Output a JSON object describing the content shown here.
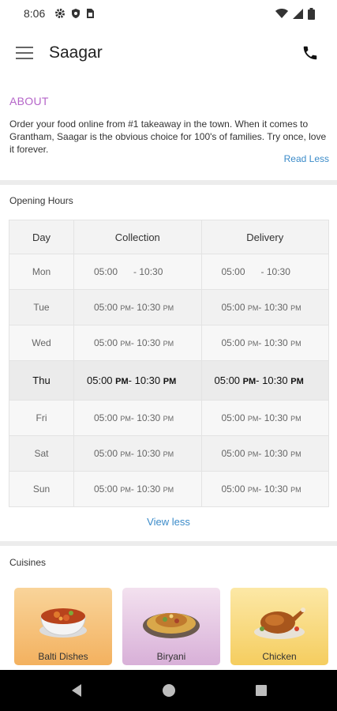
{
  "status": {
    "time": "8:06"
  },
  "header": {
    "title": "Saagar"
  },
  "about": {
    "title": "ABOUT",
    "text": "Order your food online from #1 takeaway in the town. When it comes to Grantham, Saagar is the obvious choice for 100's of families. Try once, love it forever.",
    "read_less": "Read Less"
  },
  "hours": {
    "title": "Opening Hours",
    "headers": [
      "Day",
      "Collection",
      "Delivery"
    ],
    "rows": [
      {
        "day": "Mon",
        "collection": {
          "open": "05:00",
          "open_ampm": "",
          "close": "- 10:30",
          "close_ampm": ""
        },
        "delivery": {
          "open": "05:00",
          "open_ampm": "",
          "close": "- 10:30",
          "close_ampm": ""
        }
      },
      {
        "day": "Tue",
        "collection": {
          "open": "05:00",
          "open_ampm": "PM",
          "close": "- 10:30",
          "close_ampm": "PM"
        },
        "delivery": {
          "open": "05:00",
          "open_ampm": "PM",
          "close": "- 10:30",
          "close_ampm": "PM"
        }
      },
      {
        "day": "Wed",
        "collection": {
          "open": "05:00",
          "open_ampm": "PM",
          "close": "- 10:30",
          "close_ampm": "PM"
        },
        "delivery": {
          "open": "05:00",
          "open_ampm": "PM",
          "close": "- 10:30",
          "close_ampm": "PM"
        }
      },
      {
        "day": "Thu",
        "collection": {
          "open": "05:00",
          "open_ampm": "PM",
          "close": "- 10:30",
          "close_ampm": "PM"
        },
        "delivery": {
          "open": "05:00",
          "open_ampm": "PM",
          "close": "- 10:30",
          "close_ampm": "PM"
        }
      },
      {
        "day": "Fri",
        "collection": {
          "open": "05:00",
          "open_ampm": "PM",
          "close": "- 10:30",
          "close_ampm": "PM"
        },
        "delivery": {
          "open": "05:00",
          "open_ampm": "PM",
          "close": "- 10:30",
          "close_ampm": "PM"
        }
      },
      {
        "day": "Sat",
        "collection": {
          "open": "05:00",
          "open_ampm": "PM",
          "close": "- 10:30",
          "close_ampm": "PM"
        },
        "delivery": {
          "open": "05:00",
          "open_ampm": "PM",
          "close": "- 10:30",
          "close_ampm": "PM"
        }
      },
      {
        "day": "Sun",
        "collection": {
          "open": "05:00",
          "open_ampm": "PM",
          "close": "- 10:30",
          "close_ampm": "PM"
        },
        "delivery": {
          "open": "05:00",
          "open_ampm": "PM",
          "close": "- 10:30",
          "close_ampm": "PM"
        }
      }
    ],
    "view_less": "View less"
  },
  "cuisines": {
    "title": "Cuisines",
    "items": [
      {
        "name": "Balti Dishes",
        "icon": "curry-bowl-icon",
        "gradient_top": "#f9d49a",
        "gradient_bottom": "#f3b15f"
      },
      {
        "name": "Biryani",
        "icon": "biryani-plate-icon",
        "gradient_top": "#f3e1ef",
        "gradient_bottom": "#d8b0d8"
      },
      {
        "name": "Chicken",
        "icon": "roast-chicken-icon",
        "gradient_top": "#fce8a6",
        "gradient_bottom": "#f5cd5f"
      }
    ]
  },
  "colors": {
    "accent_purple": "#b565c9",
    "link_blue": "#3b8bc9"
  }
}
